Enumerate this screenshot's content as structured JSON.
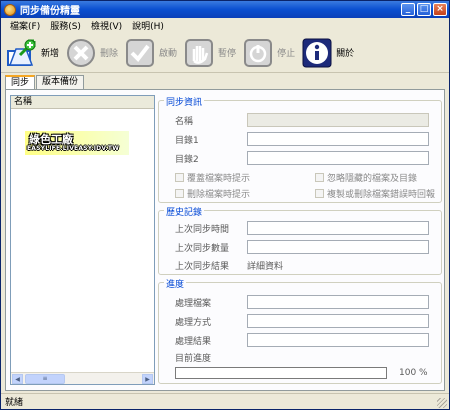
{
  "window": {
    "title": "同步備份精靈"
  },
  "menu": [
    "檔案(F)",
    "服務(S)",
    "檢視(V)",
    "說明(H)"
  ],
  "toolbar": {
    "add": "新增",
    "delete": "刪除",
    "start": "啟動",
    "pause": "暫停",
    "stop": "停止",
    "about": "關於"
  },
  "tabs": [
    "同步",
    "版本備份"
  ],
  "list": {
    "header": "名稱",
    "logo_text": "綠色工廠",
    "logo_url": "EASYLIFE.LIVEASY.IDV.TW"
  },
  "sync_info": {
    "title": "同步資訊",
    "name_label": "名稱",
    "name_value": "",
    "dir1_label": "目錄1",
    "dir1_value": "",
    "dir2_label": "目錄2",
    "dir2_value": "",
    "cb_overwrite": "覆蓋檔案時提示",
    "cb_ignore_hidden": "忽略隱藏的檔案及目錄",
    "cb_delete_prompt": "刪除檔案時提示",
    "cb_error_report": "複製或刪除檔案錯誤時回報"
  },
  "history": {
    "title": "歷史記錄",
    "last_time_label": "上次同步時間",
    "last_time_value": "",
    "last_count_label": "上次同步數量",
    "last_count_value": "",
    "last_result_label": "上次同步結果",
    "detail_link": "詳細資料"
  },
  "progress": {
    "title": "進度",
    "file_label": "處理檔案",
    "file_value": "",
    "method_label": "處理方式",
    "method_value": "",
    "result_label": "處理結果",
    "result_value": "",
    "current_label": "目前進度",
    "percent_text": "100 %",
    "fraction": 1.0
  },
  "status": {
    "text": "就緒"
  }
}
